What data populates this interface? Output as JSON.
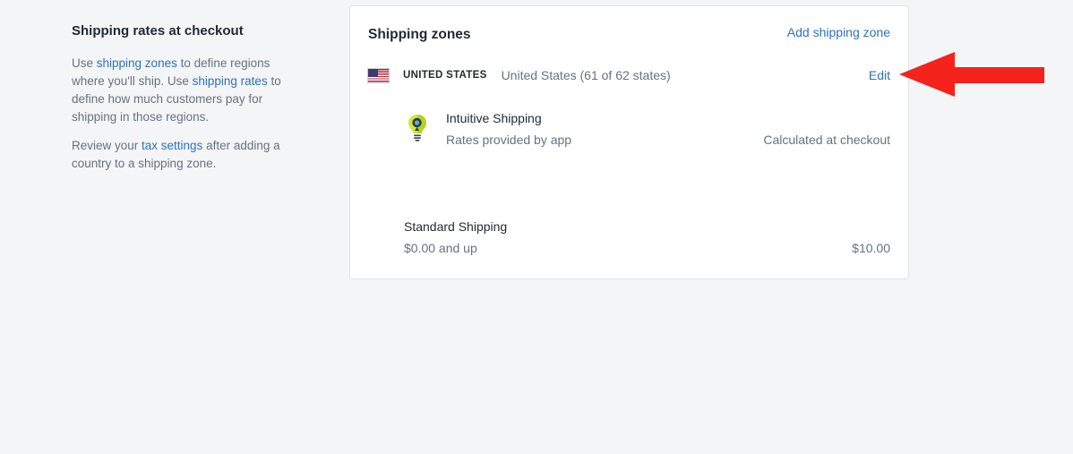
{
  "sidebar": {
    "title": "Shipping rates at checkout",
    "para1": {
      "t1": "Use ",
      "link1": "shipping zones",
      "t2": " to define regions where you'll ship. Use ",
      "link2": "shipping rates",
      "t3": " to define how much customers pay for shipping in those regions."
    },
    "para2": {
      "t1": "Review your ",
      "link": "tax settings",
      "t2": " after adding a country to a shipping zone."
    }
  },
  "card": {
    "title": "Shipping zones",
    "add_zone": "Add shipping zone",
    "zone": {
      "flag_icon": "us-flag-icon",
      "name": "UNITED STATES",
      "description": "United States (61 of 62 states)",
      "edit": "Edit"
    },
    "app_rate": {
      "icon": "lightbulb-location-icon",
      "name": "Intuitive Shipping",
      "subtitle": "Rates provided by app",
      "rate": "Calculated at checkout"
    },
    "standard_rate": {
      "name": "Standard Shipping",
      "condition": "$0.00 and up",
      "price": "$10.00"
    }
  },
  "colors": {
    "background": "#f4f5f7",
    "link": "#2e72b8",
    "annotation_arrow": "#f5231c"
  }
}
